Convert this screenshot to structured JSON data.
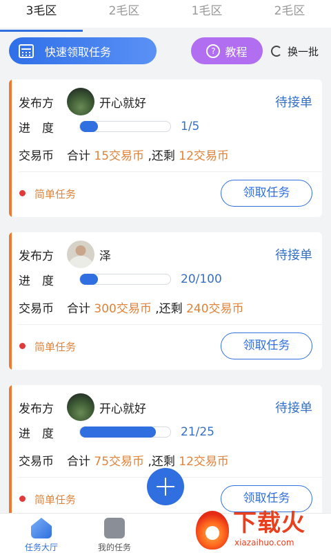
{
  "tabs": [
    "3毛区",
    "2毛区",
    "1毛区",
    "2毛区"
  ],
  "actions": {
    "quick_claim": "快速领取任务",
    "tutorial": "教程",
    "refresh": "换一批"
  },
  "labels": {
    "publisher": "发布方",
    "progress": "进　度",
    "coin": "交易币",
    "total": "合计"
  },
  "cards": [
    {
      "publisher": "开心就好",
      "avatar": "landscape-avatar",
      "status": "待接单",
      "progress_text": "1/5",
      "progress": 0.2,
      "total": "15交易币",
      "remain_sep": ",还剩",
      "remain": "12交易币",
      "task_type": "简单任务",
      "claim": "领取任务"
    },
    {
      "publisher": "泽",
      "avatar": "person-avatar",
      "status": "待接单",
      "progress_text": "20/100",
      "progress": 0.2,
      "total": "300交易币",
      "remain_sep": ",还剩",
      "remain": "240交易币",
      "task_type": "简单任务",
      "claim": "领取任务"
    },
    {
      "publisher": "开心就好",
      "avatar": "landscape-avatar",
      "status": "待接单",
      "progress_text": "21/25",
      "progress": 0.84,
      "total": "75交易币",
      "remain_sep": ",还剩",
      "remain": "12交易币",
      "task_type": "简单任务",
      "claim": "领取任务"
    }
  ],
  "bottom_nav": {
    "hall": "任务大厅",
    "mine": "我的任务"
  },
  "watermark": {
    "brand": "下载火",
    "url": "xiazaihuo.com"
  },
  "colors": {
    "accent": "#2f6fe0",
    "orange": "#e0833a",
    "tutorial": "#b16ef0",
    "status": "#3670c4"
  }
}
